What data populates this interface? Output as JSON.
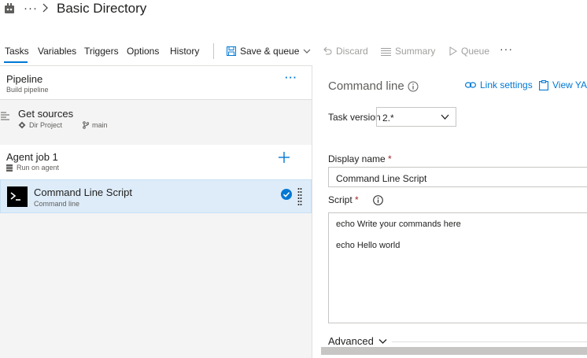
{
  "header": {
    "title": "Basic Directory",
    "more": "···"
  },
  "toolbar": {
    "tabs": [
      {
        "label": "Tasks",
        "active": true
      },
      {
        "label": "Variables"
      },
      {
        "label": "Triggers"
      },
      {
        "label": "Options"
      },
      {
        "label": "History"
      }
    ],
    "save_queue": "Save & queue",
    "discard": "Discard",
    "summary": "Summary",
    "queue": "Queue",
    "more": "···"
  },
  "pipeline": {
    "title": "Pipeline",
    "subtitle": "Build pipeline",
    "more": "···"
  },
  "sources": {
    "title": "Get sources",
    "repo": "Dir Project",
    "branch": "main"
  },
  "agent_job": {
    "title": "Agent job 1",
    "subtitle": "Run on agent"
  },
  "task": {
    "title": "Command Line Script",
    "subtitle": "Command line"
  },
  "detail": {
    "title": "Command line",
    "link_settings": "Link settings",
    "view_yaml": "View YA",
    "task_version_label": "Task version",
    "task_version_value": "2.*",
    "display_name_label": "Display name",
    "display_name_value": "Command Line Script",
    "script_label": "Script",
    "required_mark": "*",
    "script_lines": [
      "echo Write your commands here",
      "echo Hello world"
    ],
    "advanced": "Advanced"
  },
  "colors": {
    "accent": "#0078d4",
    "selected_row": "#deecf9",
    "required": "#a4262c"
  }
}
